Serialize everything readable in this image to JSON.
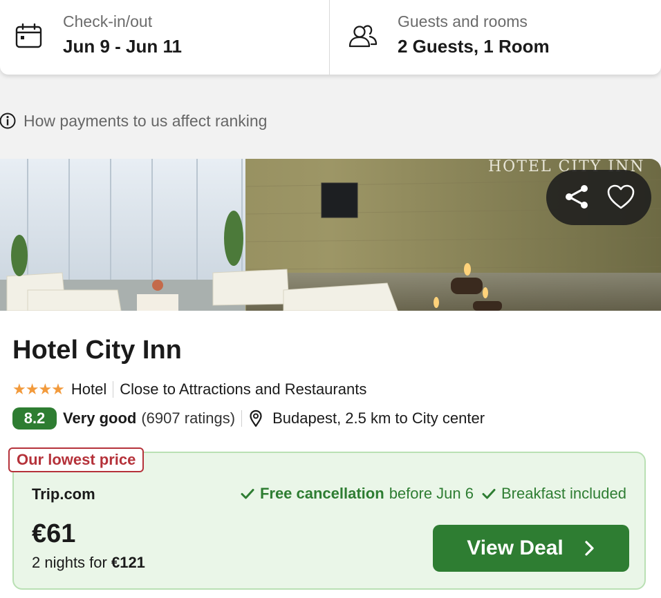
{
  "search": {
    "dates": {
      "label": "Check-in/out",
      "value": "Jun 9 - Jun 11",
      "icon": "calendar-icon"
    },
    "guests": {
      "label": "Guests and rooms",
      "value": "2 Guests, 1 Room",
      "icon": "people-icon"
    }
  },
  "ranking_note": {
    "text": "How payments to us affect ranking",
    "icon": "info-icon"
  },
  "hotel": {
    "photo": {
      "actions": [
        "share-icon",
        "heart-icon"
      ]
    },
    "name": "Hotel City Inn",
    "stars": 4,
    "stars_text": "★★★★",
    "type": "Hotel",
    "highlight": "Close to Attractions and Restaurants",
    "rating": {
      "score": "8.2",
      "word": "Very good",
      "count": "(6907 ratings)"
    },
    "location": "Budapest, 2.5 km to City center"
  },
  "deal": {
    "tag": "Our lowest price",
    "provider": "Trip.com",
    "free_cancellation": "Free cancellation",
    "cancellation_until": "before Jun 6",
    "breakfast": "Breakfast included",
    "price": "€61",
    "nights_text": "2 nights for",
    "nights_total": "€121",
    "button_label": "View Deal"
  },
  "colors": {
    "accent_green": "#2e7d32",
    "deal_bg": "#eaf6e8",
    "tag_red": "#b5323a",
    "star_orange": "#f29a3c"
  }
}
